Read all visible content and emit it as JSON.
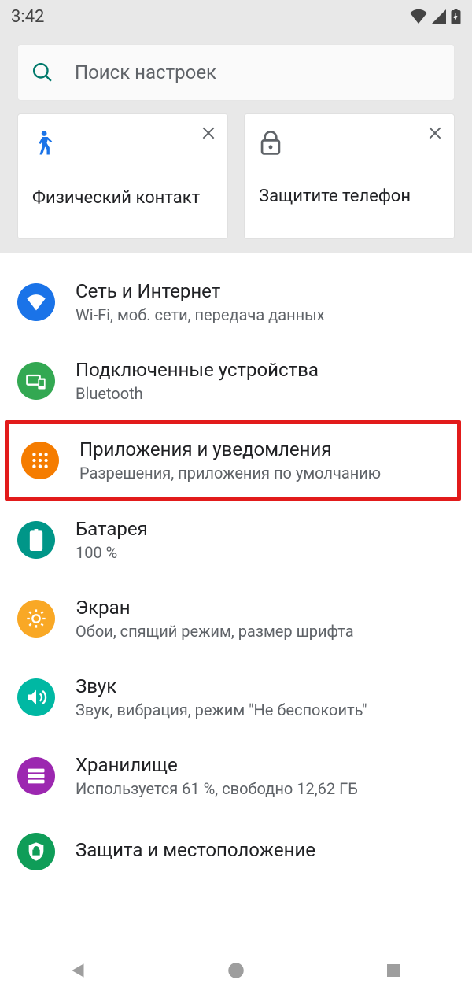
{
  "status": {
    "time": "3:42"
  },
  "search": {
    "placeholder": "Поиск настроек"
  },
  "cards": [
    {
      "icon": "person-walk",
      "label": "Физический контакт"
    },
    {
      "icon": "lock",
      "label": "Защитите телефон"
    }
  ],
  "items": [
    {
      "icon": "wifi",
      "color": "ic-blue",
      "title": "Сеть и Интернет",
      "sub": "Wi-Fi, моб. сети, передача данных"
    },
    {
      "icon": "devices",
      "color": "ic-green",
      "title": "Подключенные устройства",
      "sub": "Bluetooth"
    },
    {
      "icon": "apps",
      "color": "ic-orange",
      "title": "Приложения и уведомления",
      "sub": "Разрешения, приложения по умолчанию",
      "highlight": true
    },
    {
      "icon": "battery",
      "color": "ic-teal",
      "title": "Батарея",
      "sub": "100 %"
    },
    {
      "icon": "display",
      "color": "ic-amber",
      "title": "Экран",
      "sub": "Обои, спящий режим, размер шрифта"
    },
    {
      "icon": "sound",
      "color": "ic-teal2",
      "title": "Звук",
      "sub": "Звук, вибрация, режим \"Не беспокоить\""
    },
    {
      "icon": "storage",
      "color": "ic-purple",
      "title": "Хранилище",
      "sub": "Используется 61 %, свободно 12,62 ГБ"
    },
    {
      "icon": "security",
      "color": "ic-green2",
      "title": "Защита и местоположение",
      "sub": ""
    }
  ]
}
